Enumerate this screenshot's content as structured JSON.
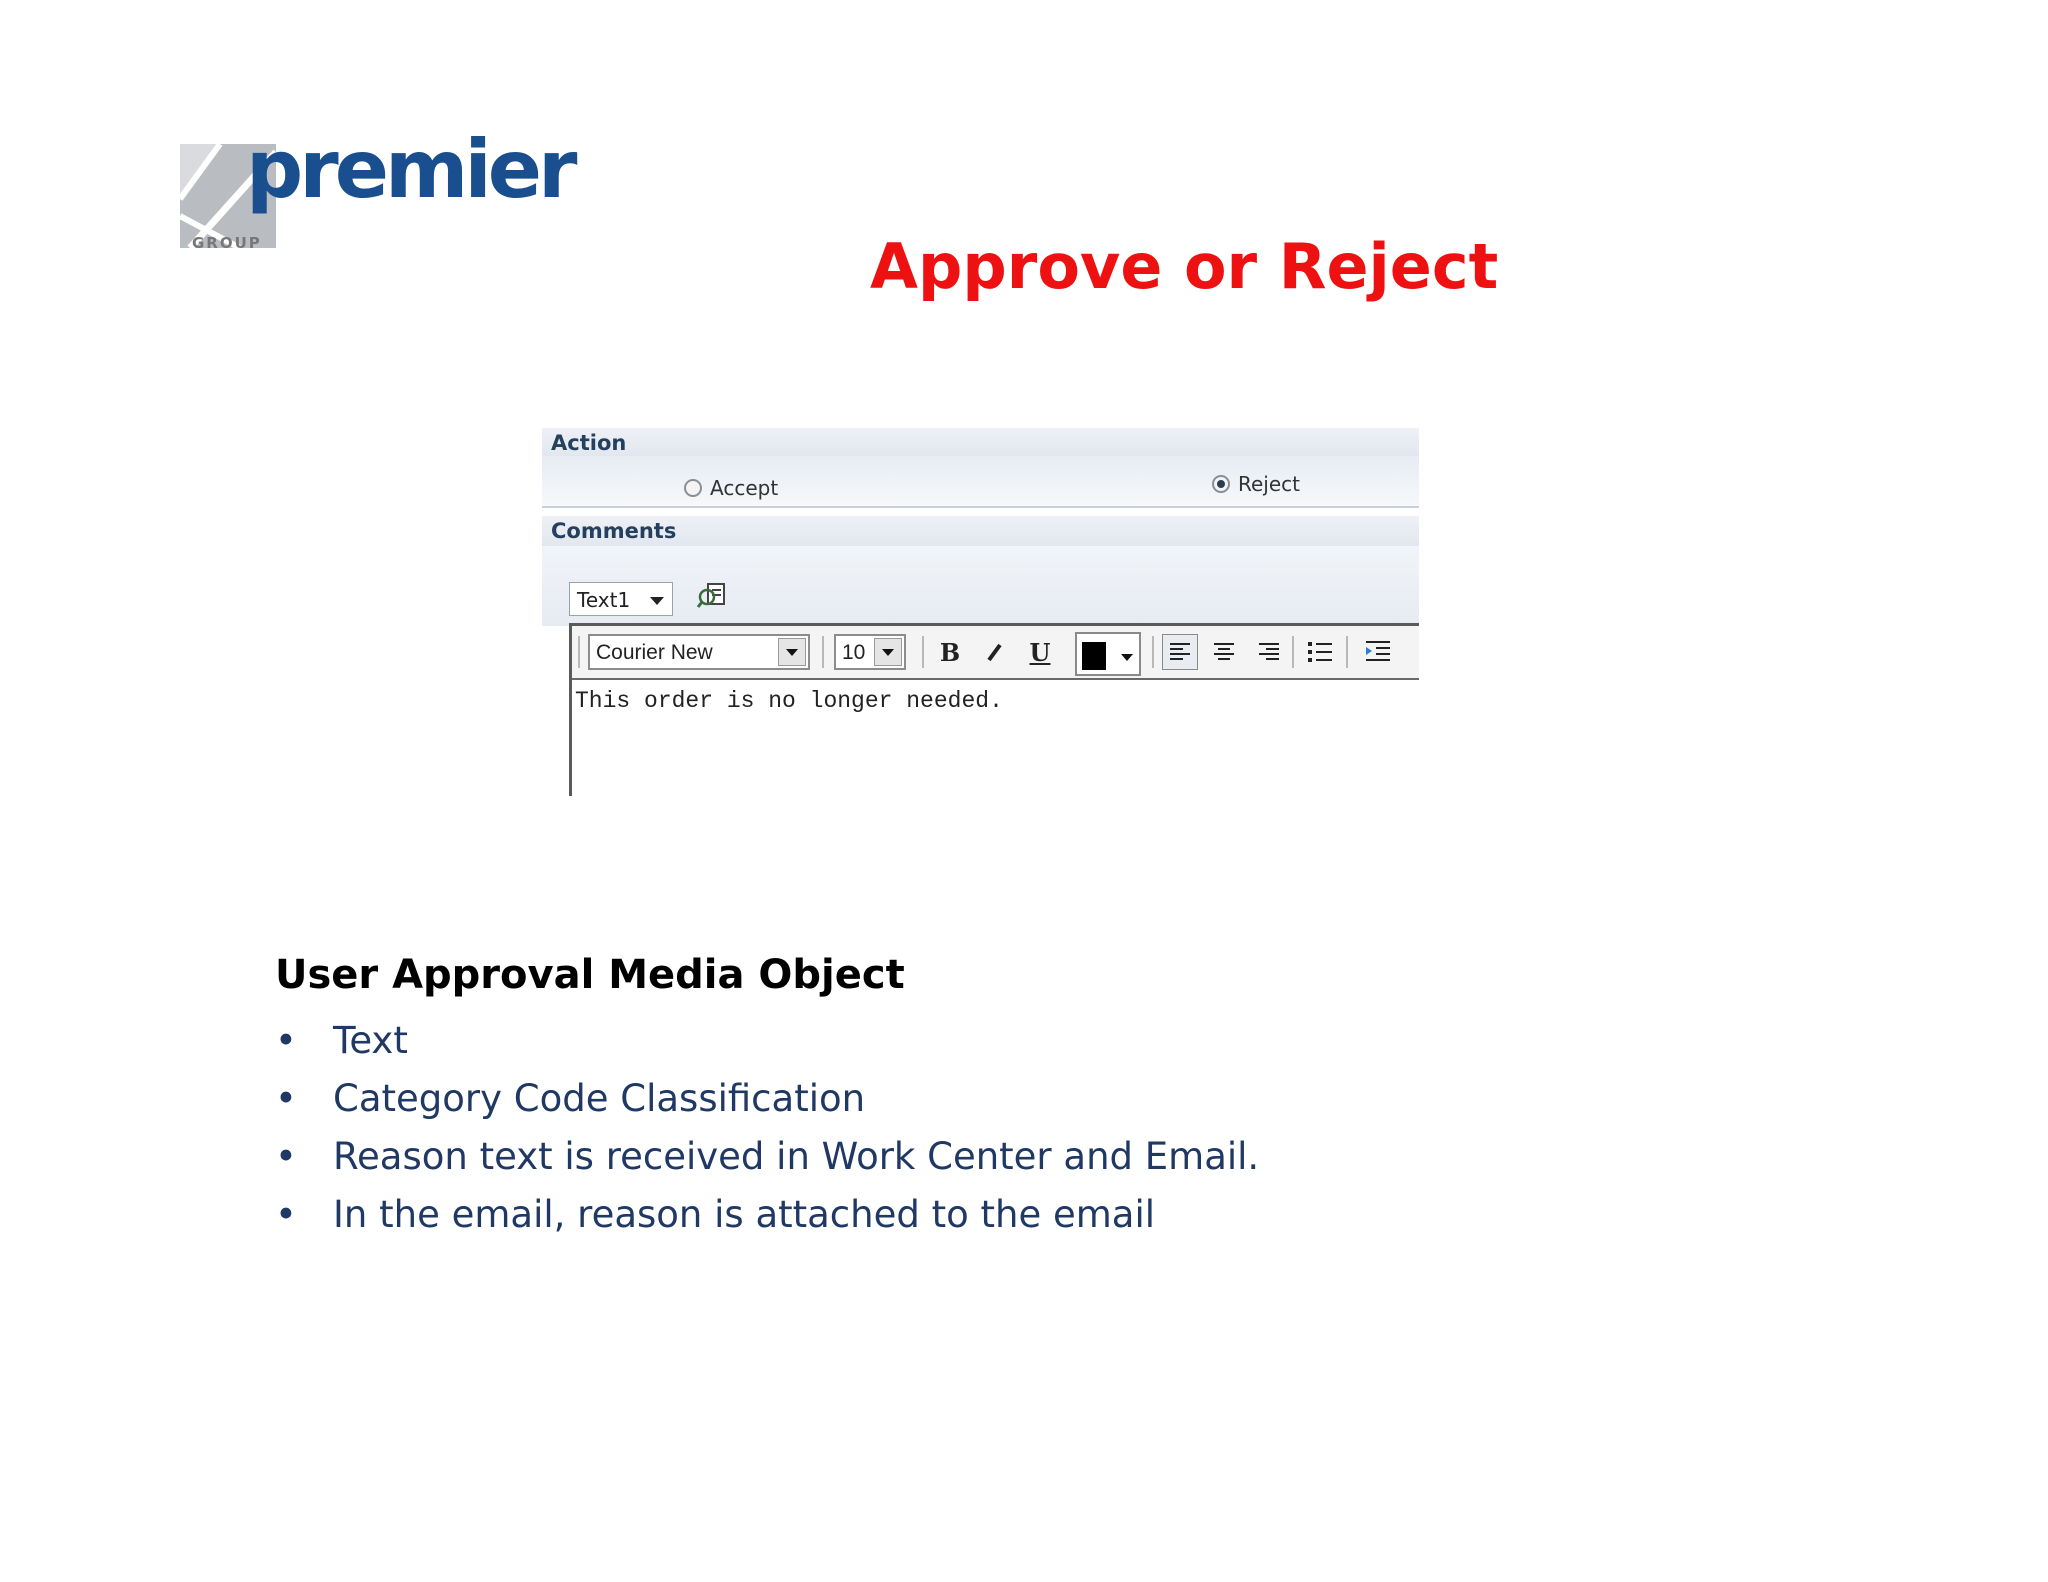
{
  "logo": {
    "name": "premier",
    "sub": "GROUP"
  },
  "title": "Approve or Reject",
  "form": {
    "action_label": "Action",
    "accept_label": "Accept",
    "reject_label": "Reject",
    "selected": "Reject",
    "comments_label": "Comments",
    "template_value": "Text1",
    "font_value": "Courier New",
    "size_value": "10",
    "bold_label": "B",
    "underline_label": "U",
    "text_color": "#000000",
    "comment_text": "This order is no longer needed."
  },
  "section": {
    "title": "User Approval Media Object",
    "bullet_char": "•",
    "bullets": [
      "Text",
      "Category Code Classification",
      "Reason text is received in Work Center and Email.",
      "In the email, reason is attached to the email"
    ]
  },
  "colors": {
    "title": "#ee1111",
    "bullets": "#203864",
    "logo": "#1a4f8f"
  }
}
